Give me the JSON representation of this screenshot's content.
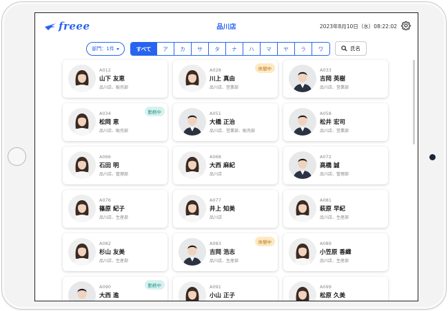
{
  "header": {
    "logo_text": "freee",
    "store": "品川店",
    "datetime": "2023年8月10日（水）08:22:02",
    "settings_icon": "gear-icon"
  },
  "filters": {
    "dept_label": "部門：1件",
    "kana_tabs": [
      "すべて",
      "ア",
      "カ",
      "サ",
      "タ",
      "ナ",
      "ハ",
      "マ",
      "ヤ",
      "ラ",
      "ワ"
    ],
    "active_kana": "すべて",
    "name_sort_label": "氏名",
    "name_sort_icon": "search-icon"
  },
  "colors": {
    "accent": "#2864f0",
    "rest_badge_bg": "#fde9c3",
    "work_badge_bg": "#d7f1ef"
  },
  "employees": [
    {
      "code": "A012",
      "name": "山下 友恵",
      "dept": "品川店、販売部",
      "badge": "",
      "photo": "woman"
    },
    {
      "code": "A028",
      "name": "川上 真由",
      "dept": "品川店、営業部",
      "badge": "休憩中",
      "photo": "woman"
    },
    {
      "code": "A033",
      "name": "吉岡 英樹",
      "dept": "品川店、営業部",
      "badge": "",
      "photo": "man"
    },
    {
      "code": "A034",
      "name": "松岡 恵",
      "dept": "品川店、販売部",
      "badge": "勤務中",
      "photo": "woman"
    },
    {
      "code": "A051",
      "name": "大橋 正治",
      "dept": "品川店、営業部、販売部",
      "badge": "",
      "photo": "man"
    },
    {
      "code": "A058",
      "name": "松井 宏司",
      "dept": "品川店、営業部",
      "badge": "",
      "photo": "man"
    },
    {
      "code": "A066",
      "name": "石田 明",
      "dept": "品川店、管理部",
      "badge": "",
      "photo": "woman"
    },
    {
      "code": "A068",
      "name": "大西 麻紀",
      "dept": "品川店",
      "badge": "",
      "photo": "woman"
    },
    {
      "code": "A072",
      "name": "高橋 誠",
      "dept": "品川店、管理部",
      "badge": "",
      "photo": "man"
    },
    {
      "code": "A076",
      "name": "篠原 紀子",
      "dept": "品川店、生産部",
      "badge": "",
      "photo": "woman"
    },
    {
      "code": "A077",
      "name": "井上 知美",
      "dept": "品川店",
      "badge": "",
      "photo": "woman"
    },
    {
      "code": "A081",
      "name": "萩原 早紀",
      "dept": "品川店、生産部",
      "badge": "",
      "photo": "woman"
    },
    {
      "code": "A082",
      "name": "杉山 友美",
      "dept": "品川店、生産部",
      "badge": "",
      "photo": "woman"
    },
    {
      "code": "A083",
      "name": "吉岡 浩志",
      "dept": "品川店、生産部",
      "badge": "休憩中",
      "photo": "man"
    },
    {
      "code": "A089",
      "name": "小笠原 香織",
      "dept": "品川店、生産部",
      "badge": "",
      "photo": "woman"
    },
    {
      "code": "A090",
      "name": "大西 進",
      "dept": "",
      "badge": "勤務中",
      "photo": "man"
    },
    {
      "code": "A091",
      "name": "小山 正子",
      "dept": "",
      "badge": "",
      "photo": "woman"
    },
    {
      "code": "A099",
      "name": "松原 久美",
      "dept": "",
      "badge": "",
      "photo": "woman"
    }
  ]
}
